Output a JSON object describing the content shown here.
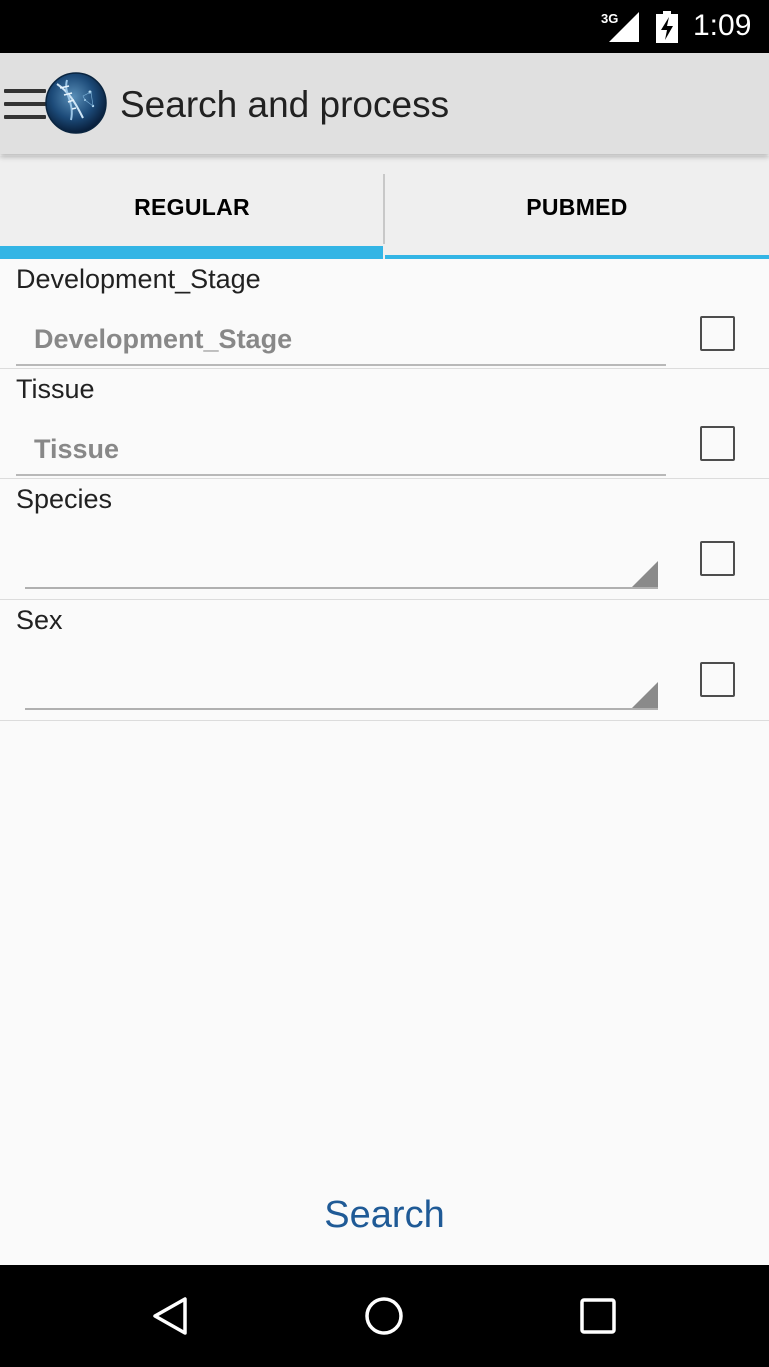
{
  "status_bar": {
    "network": "3G",
    "time": "1:09",
    "icons": [
      "signal-icon",
      "battery-charging-icon"
    ]
  },
  "app_bar": {
    "title": "Search and process",
    "icons": [
      "menu-icon",
      "app-logo-icon"
    ]
  },
  "tabs": [
    {
      "label": "REGULAR",
      "selected": true
    },
    {
      "label": "PUBMED",
      "selected": false
    }
  ],
  "fields": [
    {
      "label": "Development_Stage",
      "type": "text",
      "placeholder": "Development_Stage",
      "value": "",
      "checked": false
    },
    {
      "label": "Tissue",
      "type": "text",
      "placeholder": "Tissue",
      "value": "",
      "checked": false
    },
    {
      "label": "Species",
      "type": "dropdown",
      "value": "",
      "checked": false
    },
    {
      "label": "Sex",
      "type": "dropdown",
      "value": "",
      "checked": false
    }
  ],
  "search_button": "Search",
  "nav_bar": {
    "icons": [
      "back-icon",
      "home-icon",
      "recents-icon"
    ]
  },
  "colors": {
    "accent": "#33b5e5",
    "button_text": "#1f5a96",
    "app_bar": "#e0e0e0"
  }
}
